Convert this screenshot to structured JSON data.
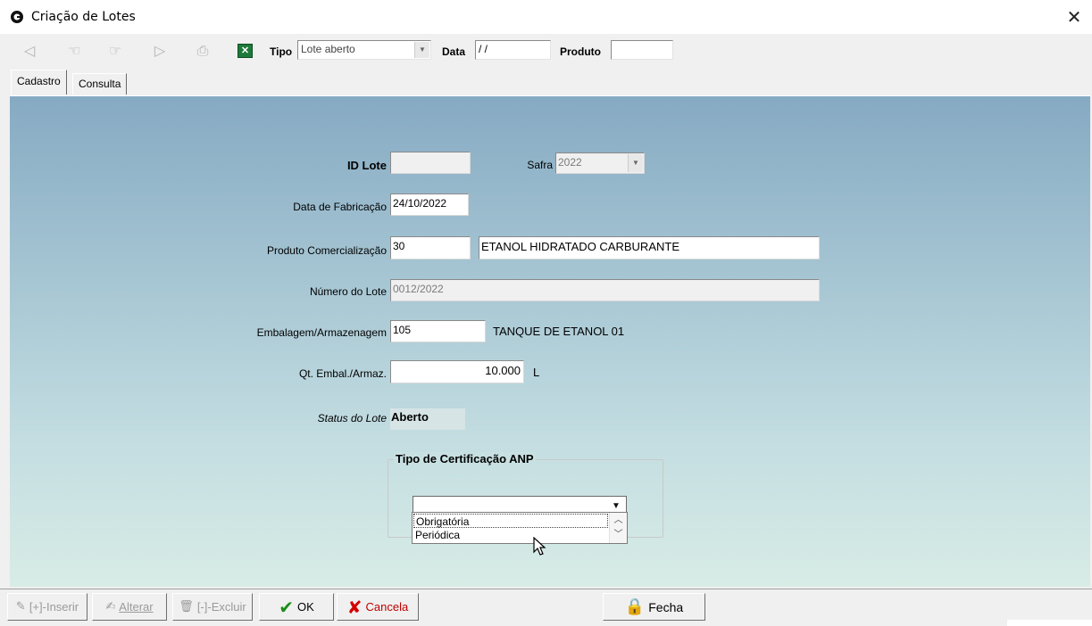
{
  "window": {
    "title": "Criação de Lotes",
    "close_symbol": "✕"
  },
  "toolbar": {
    "buttons": [
      {
        "icon": "first-record-icon",
        "glyph": "◁"
      },
      {
        "icon": "previous-record-icon",
        "glyph": "☜"
      },
      {
        "icon": "next-record-icon",
        "glyph": "☞"
      },
      {
        "icon": "last-record-icon",
        "glyph": "▷"
      },
      {
        "icon": "print-icon",
        "glyph": "⎙"
      }
    ],
    "excel_glyph": "✕",
    "tipo_label": "Tipo",
    "tipo_value": "Lote aberto",
    "data_label": "Data",
    "data_value": " / /",
    "produto_label": "Produto",
    "produto_value": ""
  },
  "tabs": [
    {
      "label": "Cadastro",
      "active": true
    },
    {
      "label": "Consulta",
      "active": false
    }
  ],
  "form": {
    "id_lote_label": "ID Lote",
    "id_lote_value": "",
    "safra_label": "Safra",
    "safra_value": "2022",
    "data_fabricacao_label": "Data de Fabricação",
    "data_fabricacao_value": "24/10/2022",
    "produto_label": "Produto Comercialização",
    "produto_code": "30",
    "produto_name": "ETANOL HIDRATADO CARBURANTE",
    "numero_lote_label": "Número do Lote",
    "numero_lote_value": "0012/2022",
    "embalagem_label": "Embalagem/Armazenagem",
    "embalagem_code": "105",
    "embalagem_name": "TANQUE DE ETANOL 01",
    "qt_label": "Qt. Embal./Armaz.",
    "qt_value": "10.000",
    "qt_unit": "L",
    "status_label": "Status do Lote",
    "status_value": "Aberto"
  },
  "certificacao": {
    "title": "Tipo de Certificação ANP",
    "selected": "",
    "options": [
      "Obrigatória",
      "Periódica"
    ]
  },
  "bottom": {
    "inserir": "[+]-Inserir",
    "alterar": "Alterar",
    "excluir": "[-]-Excluir",
    "ok": "OK",
    "cancela": "Cancela",
    "fecha": "Fecha"
  },
  "colors": {
    "accent_ok": "#1a8c1a",
    "accent_cancel": "#d40000",
    "excel_green": "#1d7a3a"
  }
}
